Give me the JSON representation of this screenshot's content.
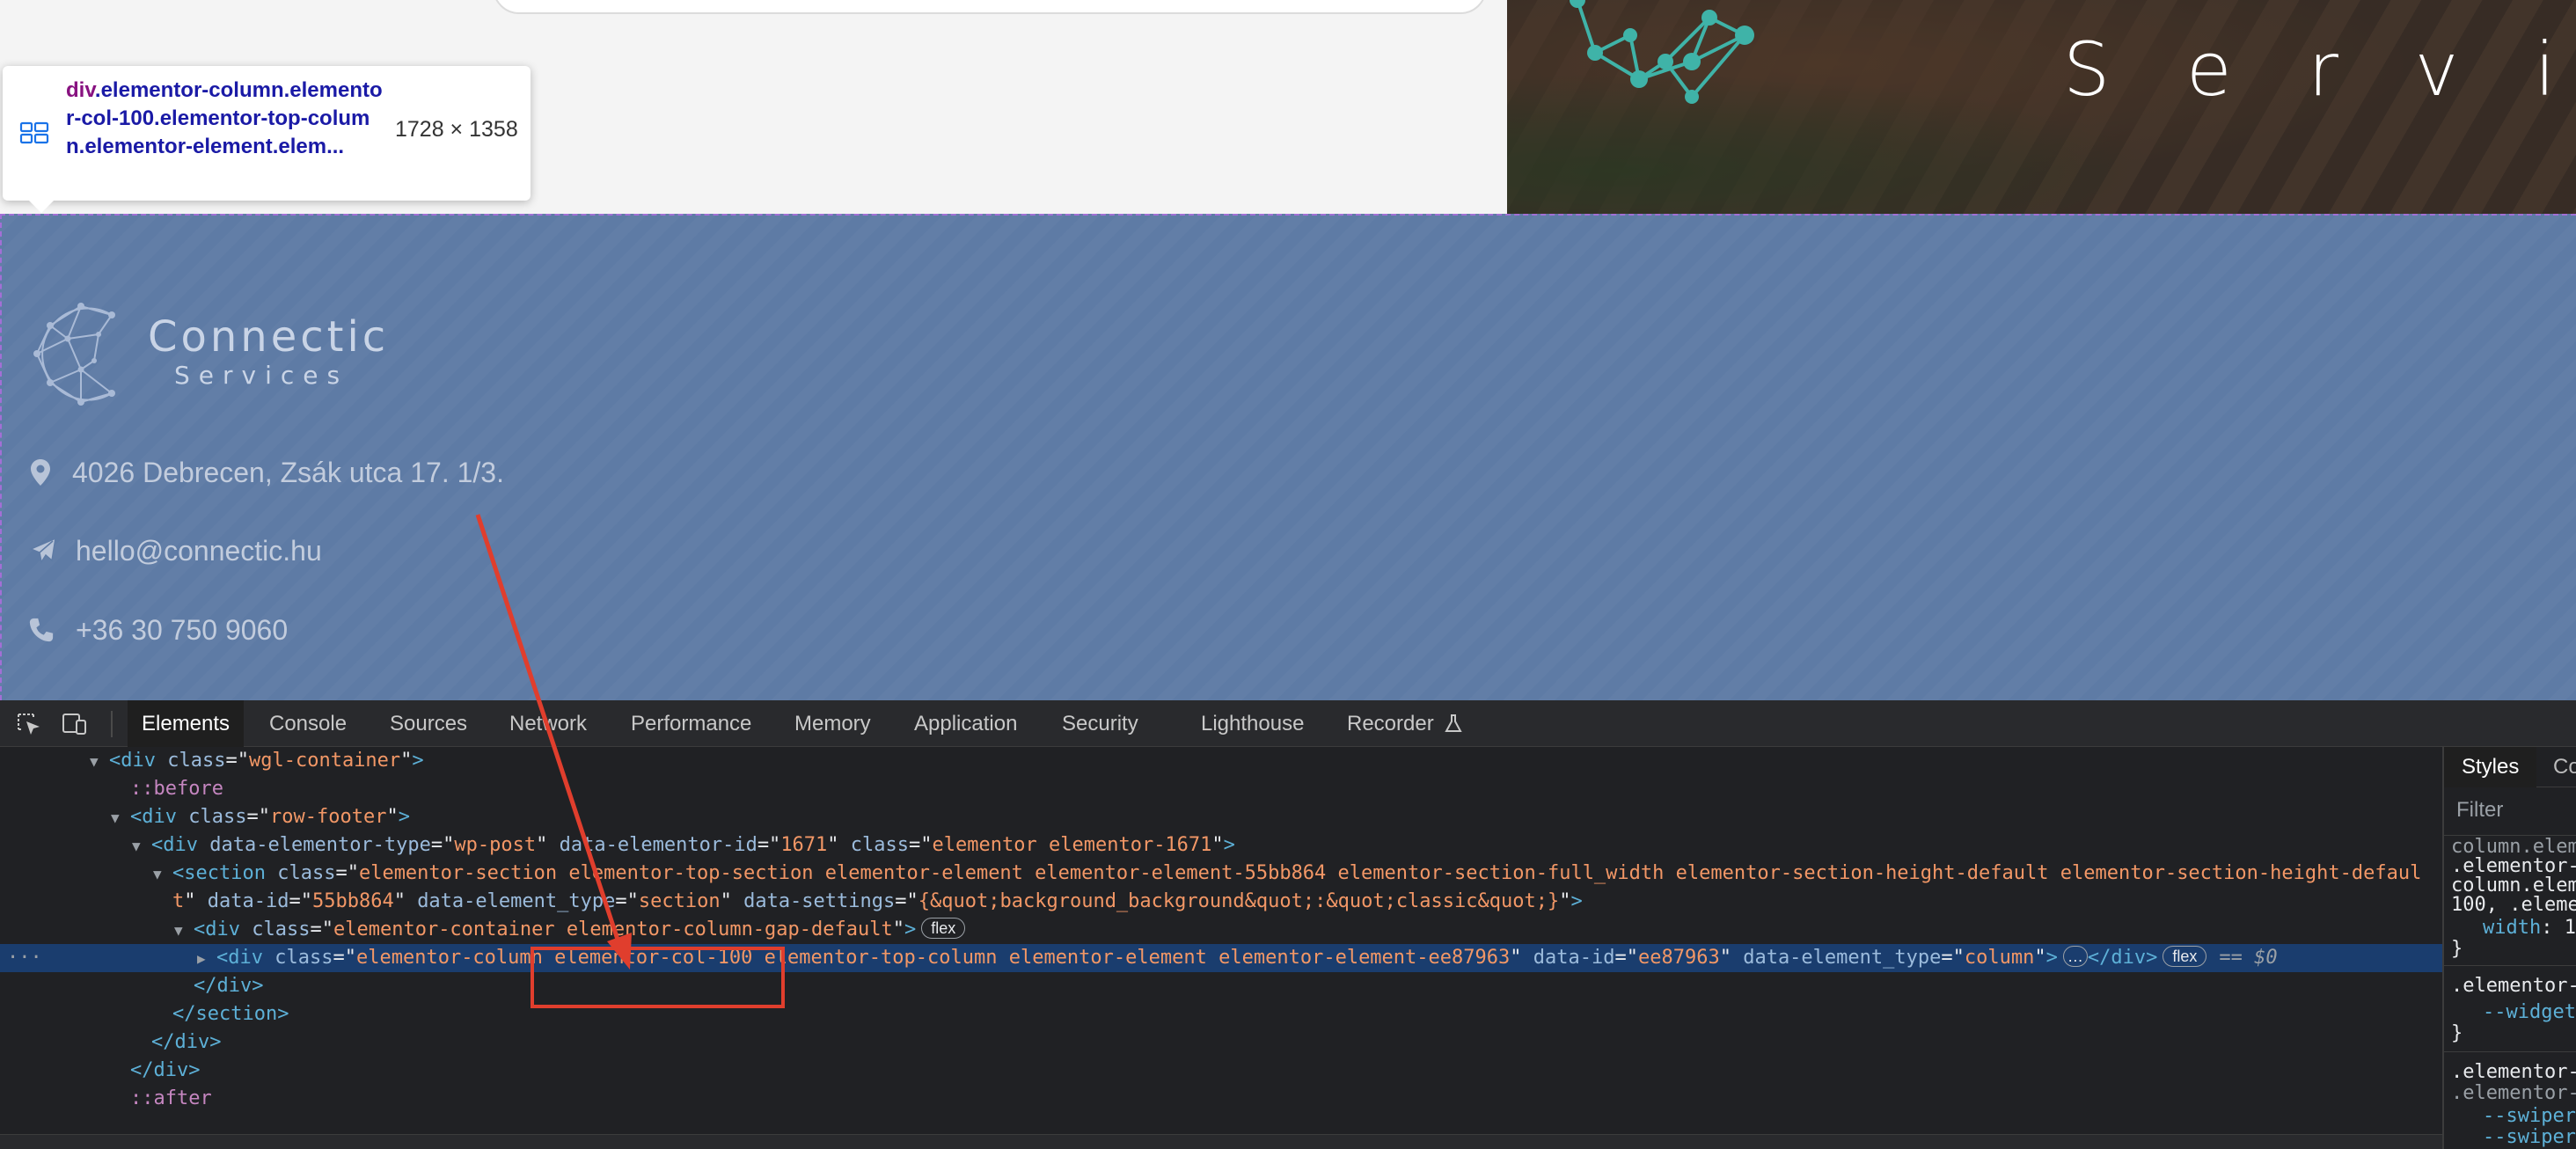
{
  "page": {
    "hero_text": "S e r v i c e s",
    "tooltip": {
      "tag": "div",
      "selector": ".elementor-column.elementor-col-100.elementor-top-column.elementor-element.elem...",
      "size": "1728 × 1358"
    },
    "footer": {
      "logo_title": "Connectic",
      "logo_subtitle": "Services",
      "address": "4026 Debrecen, Zsák utca 17. 1/3.",
      "email": "hello@connectic.hu",
      "phone": "+36 30 750 9060"
    }
  },
  "devtools": {
    "tabs": [
      "Elements",
      "Console",
      "Sources",
      "Network",
      "Performance",
      "Memory",
      "Application",
      "Security",
      "Lighthouse",
      "Recorder"
    ],
    "active_tab": "Elements",
    "dom": {
      "l1_tag": "div",
      "l1_class": "wgl-container",
      "l2_pseudo": "::before",
      "l3_tag": "div",
      "l3_class": "row-footer",
      "l4_tag": "div",
      "l4_type": "wp-post",
      "l4_id": "1671",
      "l4_class": "elementor elementor-1671",
      "l5_tag": "section",
      "l5_class_a": "elementor-section elementor-top-section elementor-element elementor-element-55bb864 elementor-section-full_width elementor-section-height-default elementor-section-height-defaul",
      "l5_class_b": "t",
      "l5_id": "55bb864",
      "l5_type": "section",
      "l5_settings": "{&quot;background_background&quot;:&quot;classic&quot;}",
      "l6_tag": "div",
      "l6_class": "elementor-container elementor-column-gap-default",
      "l7_tag": "div",
      "l7_class": "elementor-column elementor-col-100 elementor-top-column elementor-element elementor-element-ee87963",
      "l7_id": "ee87963",
      "l7_type": "column",
      "badge_flex": "flex",
      "ellipsis": "…",
      "selected_ref": "== $0",
      "close_div": "div",
      "close_section": "section",
      "after_pseudo": "::after"
    },
    "styles": {
      "tab_active": "Styles",
      "tab_next": "Co",
      "filter_placeholder": "Filter",
      "r1": "column.elem",
      "r2": ".elementor-",
      "r3": "column.elem",
      "r4": "100, .eleme",
      "r5_prop": "width",
      "r5_val": ": 1",
      "r6": "}",
      "r7": ".elementor-",
      "r8_prop": "--widget",
      "r9": "}",
      "r10": ".elementor-",
      "r11": ".elementor-",
      "r12_prop": "--swiper",
      "r13_prop": "--swiper"
    }
  }
}
